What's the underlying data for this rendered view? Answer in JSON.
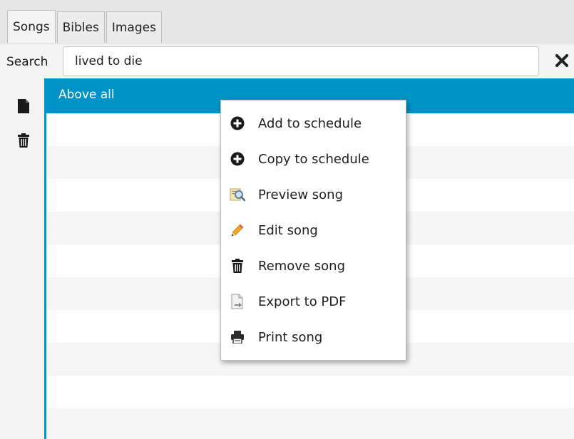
{
  "tabs": [
    {
      "label": "Songs",
      "active": true
    },
    {
      "label": "Bibles",
      "active": false
    },
    {
      "label": "Images",
      "active": false
    }
  ],
  "search": {
    "label": "Search",
    "value": "lived to die",
    "clear_icon": "close-x-icon"
  },
  "sidebar": {
    "buttons": [
      {
        "icon": "new-document-icon"
      },
      {
        "icon": "trash-icon"
      }
    ]
  },
  "song_list": {
    "items": [
      "Above all"
    ],
    "selected_index": 0
  },
  "context_menu": {
    "items": [
      {
        "label": "Add to schedule",
        "icon": "plus-circle-icon"
      },
      {
        "label": "Copy to schedule",
        "icon": "plus-circle-icon"
      },
      {
        "label": "Preview song",
        "icon": "preview-magnifier-icon"
      },
      {
        "label": "Edit song",
        "icon": "pencil-icon"
      },
      {
        "label": "Remove song",
        "icon": "trash-icon"
      },
      {
        "label": "Export to PDF",
        "icon": "export-document-icon"
      },
      {
        "label": "Print song",
        "icon": "printer-icon"
      }
    ]
  },
  "colors": {
    "selection": "#0093c7",
    "focus_border": "#0096c9",
    "row_alt": "#f6f6f6"
  }
}
